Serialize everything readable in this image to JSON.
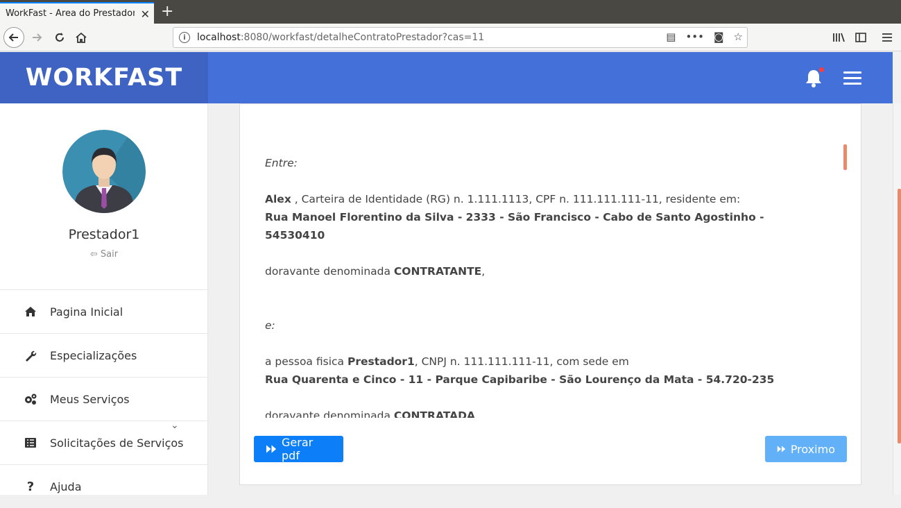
{
  "browser": {
    "tab_title": "WorkFast - Area do Prestador",
    "url_host": "localhost",
    "url_rest": ":8080/workfast/detalheContratoPrestador?cas=11"
  },
  "header": {
    "brand": "WORKFAST"
  },
  "sidebar": {
    "user_name": "Prestador1",
    "logout_label": "Sair",
    "items": [
      {
        "label": "Pagina Inicial",
        "icon": "home-icon"
      },
      {
        "label": "Especializações",
        "icon": "wrench-icon"
      },
      {
        "label": "Meus Serviços",
        "icon": "cogs-icon"
      },
      {
        "label": "Solicitações de Serviços",
        "icon": "list-icon"
      },
      {
        "label": "Ajuda",
        "icon": "question-icon"
      }
    ]
  },
  "contract": {
    "entre": "Entre:",
    "contratante_name": "Alex",
    "contratante_ids": " , Carteira de Identidade (RG) n. 1.111.1113, CPF n. 111.111.111-11, residente em:",
    "contratante_address": "Rua Manoel Florentino da Silva - 2333 - São Francisco - Cabo de Santo Agostinho - 54530410",
    "doravante1_prefix": "doravante denominada ",
    "doravante1_role": "CONTRATANTE",
    "doravante1_suffix": ",",
    "e_label": "e:",
    "contratada_prefix": "a pessoa fisica ",
    "contratada_name": "Prestador1",
    "contratada_ids": ", CNPJ n. 111.111.111-11, com sede em",
    "contratada_address": "Rua Quarenta e Cinco - 11 - Parque Capibaribe - São Lourenço da Mata - 54.720-235",
    "doravante2_prefix": "doravante denominada ",
    "doravante2_role": "CONTRATADA"
  },
  "actions": {
    "pdf_label": "Gerar pdf",
    "next_label": "Proximo"
  },
  "colors": {
    "header": "#4470d9",
    "brand_bg": "#3e63c2",
    "primary_button": "#0b7ef8",
    "disabled_button": "#62b0f8",
    "scroll_accent": "#e88b6a"
  }
}
